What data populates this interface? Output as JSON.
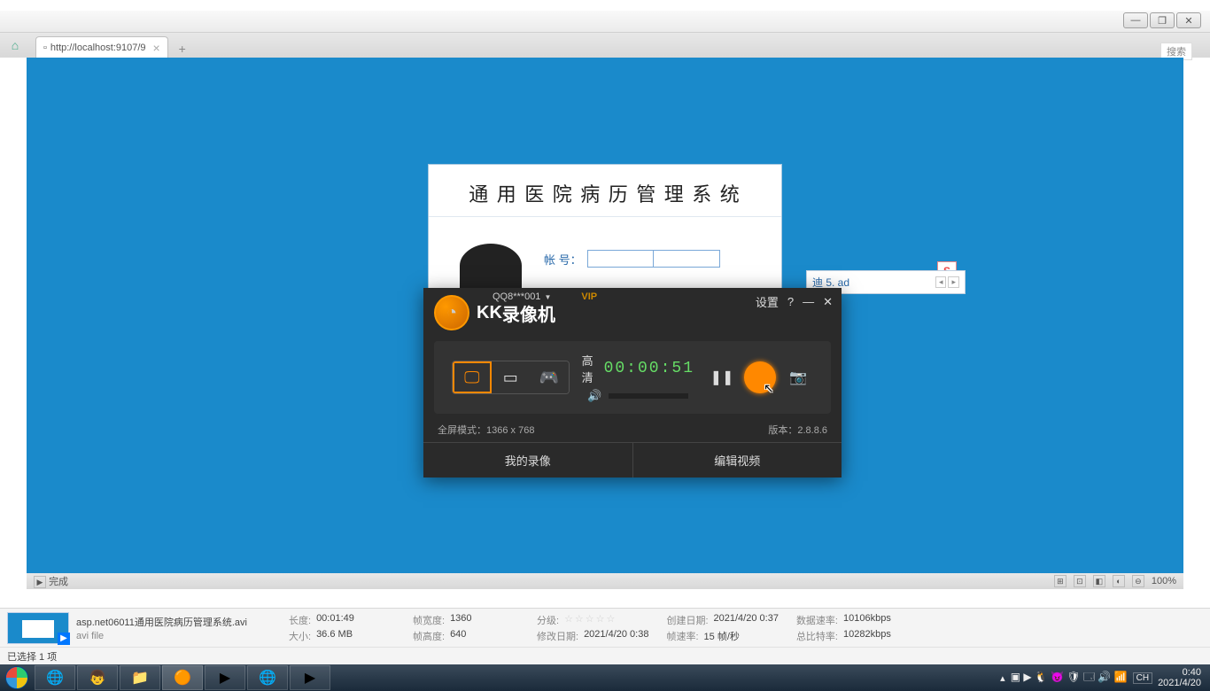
{
  "window": {
    "min": "—",
    "max": "❐",
    "close": "✕"
  },
  "browser": {
    "url": "http://localhost:9107/9",
    "tab_close": "×",
    "tab_add": "+",
    "search_placeholder": "搜索",
    "home_icon": "⌂"
  },
  "login": {
    "title": "通 用 医 院 病 历 管 理 系 统",
    "account_label": "帐    号："
  },
  "ime": {
    "item": "迪  5. ad",
    "logo": "S"
  },
  "recorder": {
    "user": "QQ8***001",
    "vip": "VIP",
    "title_en": "KK",
    "title_cn": "录像机",
    "settings": "设置",
    "help": "?",
    "min": "—",
    "close": "✕",
    "quality": "高清",
    "time": "00:00:51",
    "mode_label": "全屏模式：",
    "mode_value": "1366 x 768",
    "version_label": "版本：",
    "version_value": "2.8.8.6",
    "btn_my": "我的录像",
    "btn_edit": "编辑视频",
    "mode_screen": "🖵",
    "mode_region": "▭",
    "mode_game": "🎮",
    "vol_icon": "🔊",
    "pause": "❚❚",
    "camera": "📷"
  },
  "player_status": {
    "left_icon": "▶",
    "done": "完成",
    "zoom": "100%"
  },
  "explorer": {
    "filename": "asp.net06011通用医院病历管理系统.avi",
    "filetype": "avi file",
    "len_l": "长度:",
    "len_v": "00:01:49",
    "size_l": "大小:",
    "size_v": "36.6 MB",
    "fw_l": "帧宽度:",
    "fw_v": "1360",
    "fh_l": "帧高度:",
    "fh_v": "640",
    "rate_l": "分级:",
    "mod_l": "修改日期:",
    "mod_v": "2021/4/20 0:38",
    "create_l": "创建日期:",
    "create_v": "2021/4/20 0:37",
    "fps_l": "帧速率:",
    "fps_v": "15 帧/秒",
    "data_l": "数据速率:",
    "data_v": "10106kbps",
    "bit_l": "总比特率:",
    "bit_v": "10282kbps",
    "selection": "已选择 1 项"
  },
  "taskbar": {
    "time": "0:40",
    "date": "2021/4/20",
    "lang": "CH"
  }
}
